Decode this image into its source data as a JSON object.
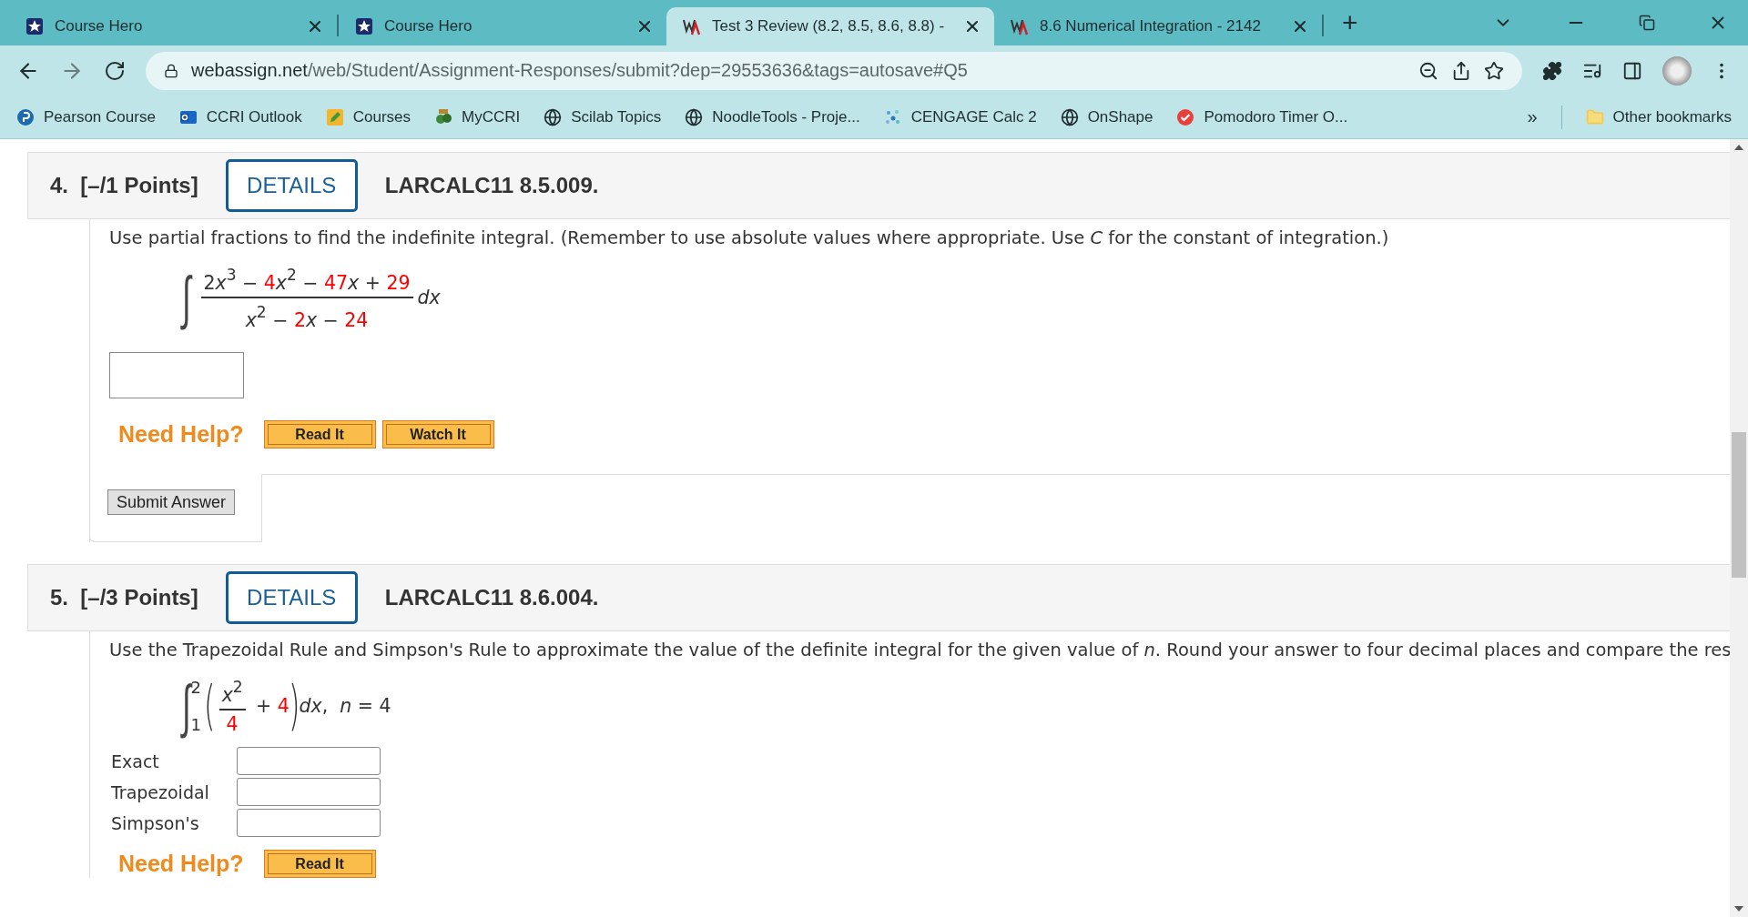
{
  "browser": {
    "tabs": [
      {
        "title": "Course Hero",
        "kind": "star",
        "selected": false
      },
      {
        "title": "Course Hero",
        "kind": "star",
        "selected": false
      },
      {
        "title": "Test 3 Review (8.2, 8.5, 8.6, 8.8) -",
        "kind": "wa",
        "selected": true
      },
      {
        "title": "8.6 Numerical Integration - 2142",
        "kind": "wa",
        "selected": false
      }
    ],
    "new_tab": "+",
    "url_domain": "webassign.net",
    "url_path": "/web/Student/Assignment-Responses/submit?dep=29553636&tags=autosave#Q5",
    "bookmarks": [
      "Pearson Course",
      "CCRI Outlook",
      "Courses",
      "MyCCRI",
      "Scilab Topics",
      "NoodleTools - Proje...",
      "CENGAGE Calc 2",
      "OnShape",
      "Pomodoro Timer O..."
    ],
    "bookmarks_more": "»",
    "other_bookmarks": "Other bookmarks"
  },
  "questions": [
    {
      "number": "4.",
      "points": "[–/1 Points]",
      "details": "DETAILS",
      "code": "LARCALC11 8.5.009.",
      "prompt": "Use partial fractions to find the indefinite integral. (Remember to use absolute values where appropriate. Use *C* for the constant of integration.)",
      "math": [
        {
          "kind": "integral",
          "sign": "∫"
        },
        {
          "kind": "fraction",
          "numerator": [
            {
              "text": "2",
              "kind": "number"
            },
            {
              "text": "x",
              "kind": "variable"
            },
            {
              "text": "3",
              "kind": "superscript"
            },
            {
              "text": " − ",
              "kind": "operator"
            },
            {
              "text": "4",
              "kind": "given"
            },
            {
              "text": "x",
              "kind": "variable"
            },
            {
              "text": "2",
              "kind": "superscript"
            },
            {
              "text": " − ",
              "kind": "operator"
            },
            {
              "text": "47",
              "kind": "given"
            },
            {
              "text": "x",
              "kind": "variable"
            },
            {
              "text": " + ",
              "kind": "operator"
            },
            {
              "text": "29",
              "kind": "given"
            }
          ],
          "denominator": [
            {
              "text": "x",
              "kind": "variable"
            },
            {
              "text": "2",
              "kind": "superscript"
            },
            {
              "text": " − ",
              "kind": "operator"
            },
            {
              "text": "2",
              "kind": "given"
            },
            {
              "text": "x",
              "kind": "variable"
            },
            {
              "text": " − ",
              "kind": "operator"
            },
            {
              "text": "24",
              "kind": "given"
            }
          ]
        },
        {
          "kind": "tokens",
          "tokens": [
            {
              "text": "dx",
              "kind": "variable"
            }
          ]
        }
      ],
      "answers": [
        {
          "kind": "box"
        }
      ],
      "help_label": "Need Help?",
      "help_buttons": [
        "Read It",
        "Watch It"
      ],
      "submit": "Submit Answer"
    },
    {
      "number": "5.",
      "points": "[–/3 Points]",
      "details": "DETAILS",
      "code": "LARCALC11 8.6.004.",
      "prompt": "Use the Trapezoidal Rule and Simpson's Rule to approximate the value of the definite integral for the given value of *n*. Round your answer to four decimal places and compare the res",
      "math": [
        {
          "kind": "integral",
          "sign": "∫",
          "upper": "2",
          "lower": "1"
        },
        {
          "kind": "paren",
          "text": "("
        },
        {
          "kind": "fraction",
          "numerator": [
            {
              "text": "x",
              "kind": "variable"
            },
            {
              "text": "2",
              "kind": "superscript"
            }
          ],
          "denominator": [
            {
              "text": "4",
              "kind": "given"
            }
          ]
        },
        {
          "kind": "tokens",
          "tokens": [
            {
              "text": " + ",
              "kind": "operator"
            },
            {
              "text": "4",
              "kind": "given"
            }
          ]
        },
        {
          "kind": "paren",
          "text": ")"
        },
        {
          "kind": "tokens",
          "tokens": [
            {
              "text": "dx",
              "kind": "variable"
            },
            {
              "text": ",  ",
              "kind": "operator"
            },
            {
              "text": "n",
              "kind": "variable"
            },
            {
              "text": " = 4",
              "kind": "operator"
            }
          ]
        }
      ],
      "answers": [
        {
          "kind": "labeled",
          "label": "Exact"
        },
        {
          "kind": "labeled",
          "label": "Trapezoidal"
        },
        {
          "kind": "labeled",
          "label": "Simpson's"
        }
      ],
      "help_label": "Need Help?",
      "help_buttons": [
        "Read It"
      ]
    }
  ]
}
